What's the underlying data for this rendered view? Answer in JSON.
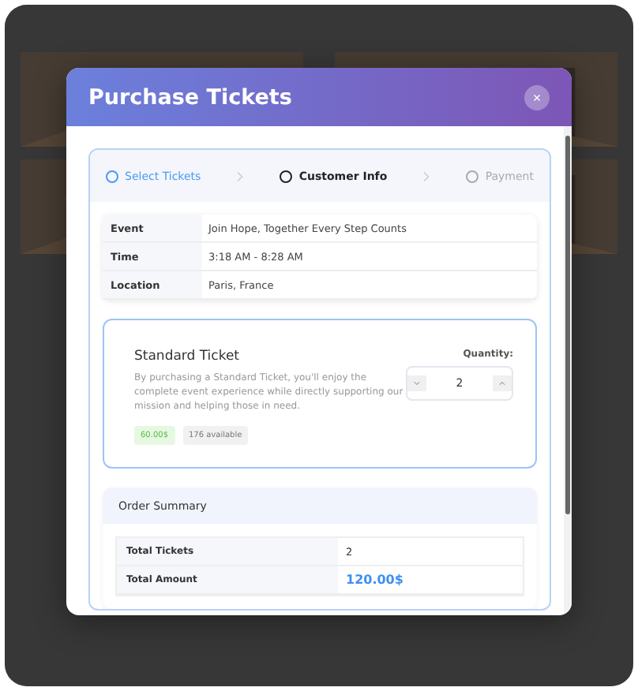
{
  "modal": {
    "title": "Purchase Tickets",
    "close": "×",
    "steps": [
      {
        "label": "Select Tickets",
        "done": true,
        "selected": false
      },
      {
        "label": "Customer Info",
        "done": false,
        "selected": true
      },
      {
        "label": "Payment",
        "done": false,
        "selected": false
      }
    ],
    "details": [
      {
        "label": "Event",
        "value": "Join Hope, Together Every Step Counts"
      },
      {
        "label": "Time",
        "value": "3:18 AM - 8:28 AM"
      },
      {
        "label": "Location",
        "value": "Paris, France"
      }
    ],
    "ticket": {
      "name": "Standard Ticket",
      "description": "By purchasing a Standard Ticket, you'll enjoy the complete event experience while directly supporting our mission and helping those in need.",
      "price": "60.00$",
      "available": "176 available",
      "quantity_label": "Quantity:",
      "quantity": "2"
    },
    "summary": {
      "title": "Order Summary",
      "rows": [
        {
          "label": "Total Tickets",
          "value": "2",
          "kind": "plain"
        },
        {
          "label": "Total Amount",
          "value": "120.00$",
          "kind": "total"
        }
      ]
    }
  }
}
